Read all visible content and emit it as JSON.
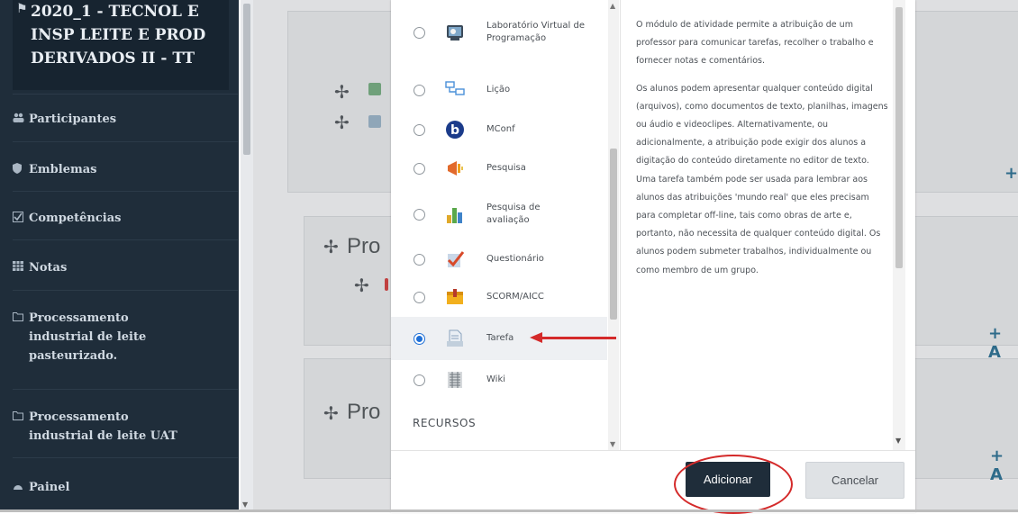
{
  "sidebar": {
    "course_title_lines": [
      "2020_1 - TECNOL E",
      "INSP LEITE E PROD",
      "DERIVADOS II - TT"
    ],
    "items": [
      {
        "label": "Participantes",
        "icon": "users-icon"
      },
      {
        "label": "Emblemas",
        "icon": "shield-icon"
      },
      {
        "label": "Competências",
        "icon": "checkbox-icon"
      },
      {
        "label": "Notas",
        "icon": "grid-icon"
      },
      {
        "label_lines": [
          "Processamento",
          "industrial de leite",
          "pasteurizado."
        ],
        "icon": "folder-icon"
      },
      {
        "label_lines": [
          "Processamento",
          "industrial de leite UAT"
        ],
        "icon": "folder-icon"
      },
      {
        "label": "Painel",
        "icon": "dashboard-icon"
      }
    ]
  },
  "main": {
    "section_prefix": "Pro",
    "add_prefix": "+ A"
  },
  "chooser": {
    "options": [
      {
        "label": "Laboratório Virtual de Programação",
        "icon": "vpl-icon",
        "selected": false
      },
      {
        "label": "Lição",
        "icon": "lesson-icon",
        "selected": false
      },
      {
        "label": "MConf",
        "icon": "mconf-icon",
        "selected": false
      },
      {
        "label": "Pesquisa",
        "icon": "survey-icon",
        "selected": false
      },
      {
        "label": "Pesquisa de avaliação",
        "icon": "feedback-icon",
        "selected": false
      },
      {
        "label": "Questionário",
        "icon": "quiz-icon",
        "selected": false
      },
      {
        "label": "SCORM/AICC",
        "icon": "scorm-icon",
        "selected": false
      },
      {
        "label": "Tarefa",
        "icon": "assignment-icon",
        "selected": true
      },
      {
        "label": "Wiki",
        "icon": "wiki-icon",
        "selected": false
      }
    ],
    "section_heading": "RECURSOS"
  },
  "description": {
    "paragraph1": "O módulo de atividade permite a atribuição de um professor para comunicar tarefas, recolher o trabalho e fornecer notas e comentários.",
    "paragraph2": "Os alunos podem apresentar qualquer conteúdo digital (arquivos), como documentos de texto, planilhas, imagens ou áudio e videoclipes. Alternativamente, ou adicionalmente, a atribuição pode exigir dos alunos a digitação do conteúdo diretamente no editor de texto. Uma tarefa também pode ser usada para lembrar aos alunos das atribuições 'mundo real' que eles precisam para completar off-line, tais como obras de arte e, portanto, não necessita de qualquer conteúdo digital. Os alunos podem submeter trabalhos, individualmente ou como membro de um grupo."
  },
  "footer": {
    "add_label": "Adicionar",
    "cancel_label": "Cancelar"
  },
  "colors": {
    "sidebar_bg": "#1f2d3a",
    "primary_button": "#1f2d3a",
    "annotation_red": "#d42a2a",
    "radio_selected": "#1e6fd6"
  }
}
